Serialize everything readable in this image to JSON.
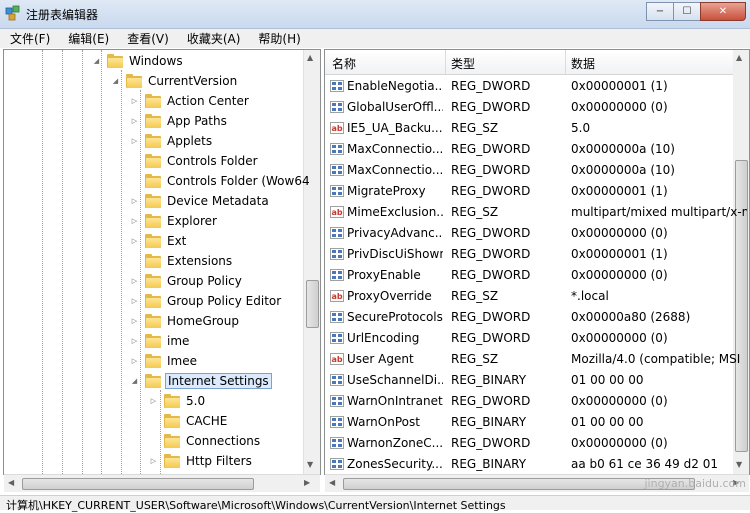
{
  "window": {
    "title": "注册表编辑器",
    "buttons": {
      "minimize": "−",
      "maximize": "☐",
      "close": "✕"
    }
  },
  "menu": [
    "文件(F)",
    "编辑(E)",
    "查看(V)",
    "收藏夹(A)",
    "帮助(H)"
  ],
  "tree": {
    "items": [
      {
        "label": "Windows",
        "expander": "open"
      },
      {
        "label": "CurrentVersion",
        "expander": "open"
      },
      {
        "label": "Action Center",
        "expander": "closed"
      },
      {
        "label": "App Paths",
        "expander": "closed"
      },
      {
        "label": "Applets",
        "expander": "closed"
      },
      {
        "label": "Controls Folder",
        "expander": "none"
      },
      {
        "label": "Controls Folder (Wow64",
        "expander": "none"
      },
      {
        "label": "Device Metadata",
        "expander": "closed"
      },
      {
        "label": "Explorer",
        "expander": "closed"
      },
      {
        "label": "Ext",
        "expander": "closed"
      },
      {
        "label": "Extensions",
        "expander": "none"
      },
      {
        "label": "Group Policy",
        "expander": "closed"
      },
      {
        "label": "Group Policy Editor",
        "expander": "closed"
      },
      {
        "label": "HomeGroup",
        "expander": "closed"
      },
      {
        "label": "ime",
        "expander": "closed"
      },
      {
        "label": "Imee",
        "expander": "closed"
      },
      {
        "label": "Internet Settings",
        "expander": "open",
        "selected": true
      },
      {
        "label": "5.0",
        "expander": "closed"
      },
      {
        "label": "CACHE",
        "expander": "none"
      },
      {
        "label": "Connections",
        "expander": "none"
      },
      {
        "label": "Http Filters",
        "expander": "closed"
      }
    ]
  },
  "list": {
    "columns": {
      "name": "名称",
      "type": "类型",
      "data": "数据"
    },
    "rows": [
      {
        "icon": "dword",
        "name": "EnableNegotia...",
        "type": "REG_DWORD",
        "data": "0x00000001 (1)"
      },
      {
        "icon": "dword",
        "name": "GlobalUserOffl...",
        "type": "REG_DWORD",
        "data": "0x00000000 (0)"
      },
      {
        "icon": "string",
        "name": "IE5_UA_Backu...",
        "type": "REG_SZ",
        "data": "5.0"
      },
      {
        "icon": "dword",
        "name": "MaxConnectio...",
        "type": "REG_DWORD",
        "data": "0x0000000a (10)"
      },
      {
        "icon": "dword",
        "name": "MaxConnectio...",
        "type": "REG_DWORD",
        "data": "0x0000000a (10)"
      },
      {
        "icon": "dword",
        "name": "MigrateProxy",
        "type": "REG_DWORD",
        "data": "0x00000001 (1)"
      },
      {
        "icon": "string",
        "name": "MimeExclusion...",
        "type": "REG_SZ",
        "data": "multipart/mixed multipart/x-m"
      },
      {
        "icon": "dword",
        "name": "PrivacyAdvanc...",
        "type": "REG_DWORD",
        "data": "0x00000000 (0)"
      },
      {
        "icon": "dword",
        "name": "PrivDiscUiShown",
        "type": "REG_DWORD",
        "data": "0x00000001 (1)"
      },
      {
        "icon": "dword",
        "name": "ProxyEnable",
        "type": "REG_DWORD",
        "data": "0x00000000 (0)"
      },
      {
        "icon": "string",
        "name": "ProxyOverride",
        "type": "REG_SZ",
        "data": "*.local"
      },
      {
        "icon": "dword",
        "name": "SecureProtocols",
        "type": "REG_DWORD",
        "data": "0x00000a80 (2688)"
      },
      {
        "icon": "dword",
        "name": "UrlEncoding",
        "type": "REG_DWORD",
        "data": "0x00000000 (0)"
      },
      {
        "icon": "string",
        "name": "User Agent",
        "type": "REG_SZ",
        "data": "Mozilla/4.0 (compatible; MSI"
      },
      {
        "icon": "dword",
        "name": "UseSchannelDi...",
        "type": "REG_BINARY",
        "data": "01 00 00 00"
      },
      {
        "icon": "dword",
        "name": "WarnOnIntranet",
        "type": "REG_DWORD",
        "data": "0x00000000 (0)"
      },
      {
        "icon": "dword",
        "name": "WarnOnPost",
        "type": "REG_BINARY",
        "data": "01 00 00 00"
      },
      {
        "icon": "dword",
        "name": "WarnonZoneC...",
        "type": "REG_DWORD",
        "data": "0x00000000 (0)"
      },
      {
        "icon": "dword",
        "name": "ZonesSecurity...",
        "type": "REG_BINARY",
        "data": "aa b0 61 ce 36 49 d2 01"
      }
    ]
  },
  "status": {
    "path": "计算机\\HKEY_CURRENT_USER\\Software\\Microsoft\\Windows\\CurrentVersion\\Internet Settings"
  },
  "watermark": "jingyan.baidu.com"
}
